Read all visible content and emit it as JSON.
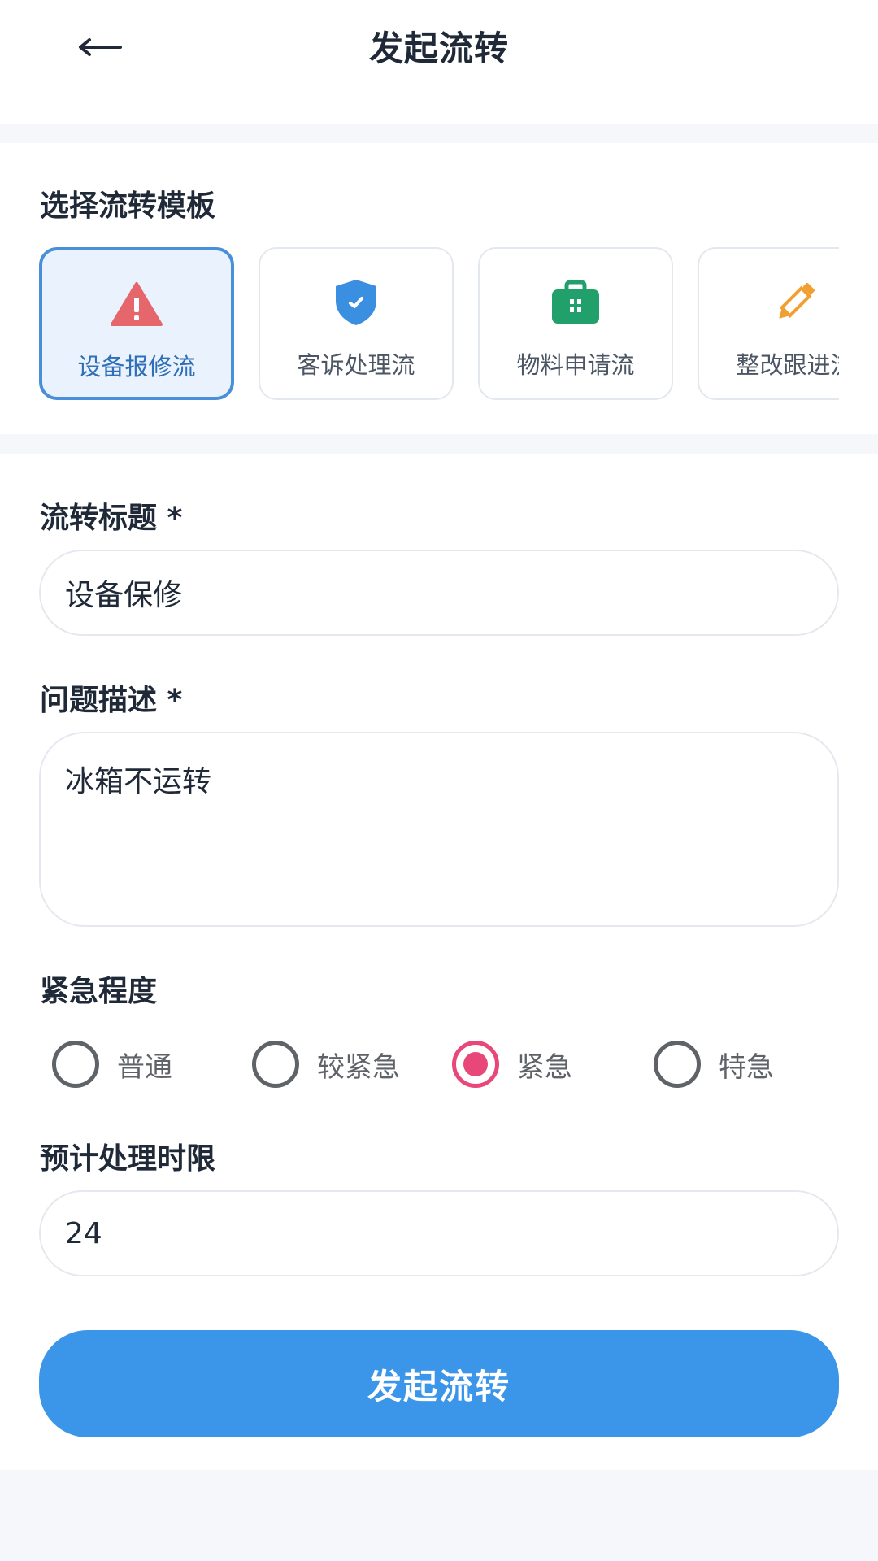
{
  "header": {
    "title": "发起流转",
    "back_icon": "back-arrow-icon"
  },
  "templates": {
    "label": "选择流转模板",
    "items": [
      {
        "name": "设备报修流",
        "icon": "warning-icon",
        "color": "#e5676b",
        "selected": true
      },
      {
        "name": "客诉处理流",
        "icon": "shield-icon",
        "color": "#3b8fe0",
        "selected": false
      },
      {
        "name": "物料申请流",
        "icon": "briefcase-icon",
        "color": "#22a06b",
        "selected": false
      },
      {
        "name": "整改跟进流",
        "icon": "pencil-icon",
        "color": "#f0a030",
        "selected": false
      }
    ]
  },
  "form": {
    "title_label": "流转标题 *",
    "title_value": "设备保修",
    "desc_label": "问题描述 *",
    "desc_value": "冰箱不运转",
    "urgency_label": "紧急程度",
    "urgency_options": [
      {
        "label": "普通",
        "checked": false
      },
      {
        "label": "较紧急",
        "checked": false
      },
      {
        "label": "紧急",
        "checked": true
      },
      {
        "label": "特急",
        "checked": false
      }
    ],
    "deadline_label": "预计处理时限",
    "deadline_value": "24",
    "submit_label": "发起流转"
  },
  "colors": {
    "primary": "#3b95e8",
    "selected_border": "#4a90d9",
    "radio_checked": "#e8477a"
  }
}
